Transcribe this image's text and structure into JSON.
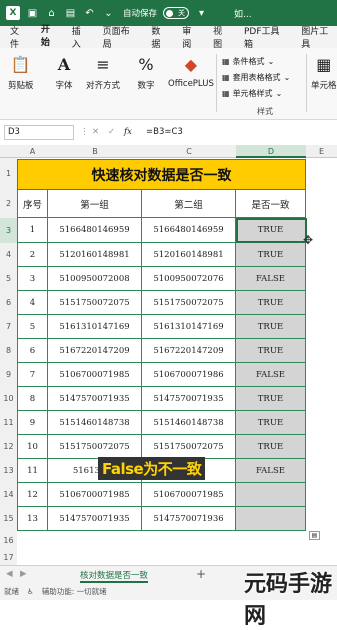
{
  "titlebar": {
    "autosave": "自动保存",
    "toggle": "关",
    "filename": "如..."
  },
  "menu": [
    "文件",
    "开始",
    "插入",
    "页面布局",
    "数据",
    "审阅",
    "视图",
    "PDF工具箱",
    "图片工具"
  ],
  "ribbon": {
    "clipboard": "剪贴板",
    "font": "字体",
    "align": "对齐方式",
    "number": "数字",
    "office": "OfficePLUS",
    "cond": "条件格式",
    "table": "套用表格格式",
    "cellstyle": "单元格样式",
    "styles": "样式",
    "cells": "单元格"
  },
  "namebox": "D3",
  "formula": "=B3=C3",
  "fx": "fx",
  "columns": [
    "A",
    "B",
    "C",
    "D",
    "E"
  ],
  "rows": [
    "1",
    "2",
    "3",
    "4",
    "5",
    "6",
    "7",
    "8",
    "9",
    "10",
    "11",
    "12",
    "13",
    "14",
    "15",
    "16",
    "17"
  ],
  "table": {
    "title": "快速核对数据是否一致",
    "headers": [
      "序号",
      "第一组",
      "第二组",
      "是否一致"
    ],
    "rows": [
      {
        "n": "1",
        "a": "5166480146959",
        "b": "5166480146959",
        "r": "TRUE"
      },
      {
        "n": "2",
        "a": "5120160148981",
        "b": "5120160148981",
        "r": "TRUE"
      },
      {
        "n": "3",
        "a": "5100950072008",
        "b": "5100950072076",
        "r": "FALSE"
      },
      {
        "n": "4",
        "a": "5151750072075",
        "b": "5151750072075",
        "r": "TRUE"
      },
      {
        "n": "5",
        "a": "5161310147169",
        "b": "5161310147169",
        "r": "TRUE"
      },
      {
        "n": "6",
        "a": "5167220147209",
        "b": "5167220147209",
        "r": "TRUE"
      },
      {
        "n": "7",
        "a": "5106700071985",
        "b": "5106700071986",
        "r": "FALSE"
      },
      {
        "n": "8",
        "a": "5147570071935",
        "b": "5147570071935",
        "r": "TRUE"
      },
      {
        "n": "9",
        "a": "5151460148738",
        "b": "5151460148738",
        "r": "TRUE"
      },
      {
        "n": "10",
        "a": "5151750072075",
        "b": "5151750072075",
        "r": "TRUE"
      },
      {
        "n": "11",
        "a": "51613101",
        "b": "",
        "r": "FALSE"
      },
      {
        "n": "12",
        "a": "5106700071985",
        "b": "5106700071985",
        "r": ""
      },
      {
        "n": "13",
        "a": "5147570071935",
        "b": "5147570071936",
        "r": ""
      }
    ]
  },
  "caption": "False为不一致",
  "sheet_tab": "核对数据是否一致",
  "status": {
    "ready": "就绪",
    "access": "辅助功能: 一切就绪"
  },
  "watermark": "元码手游网"
}
